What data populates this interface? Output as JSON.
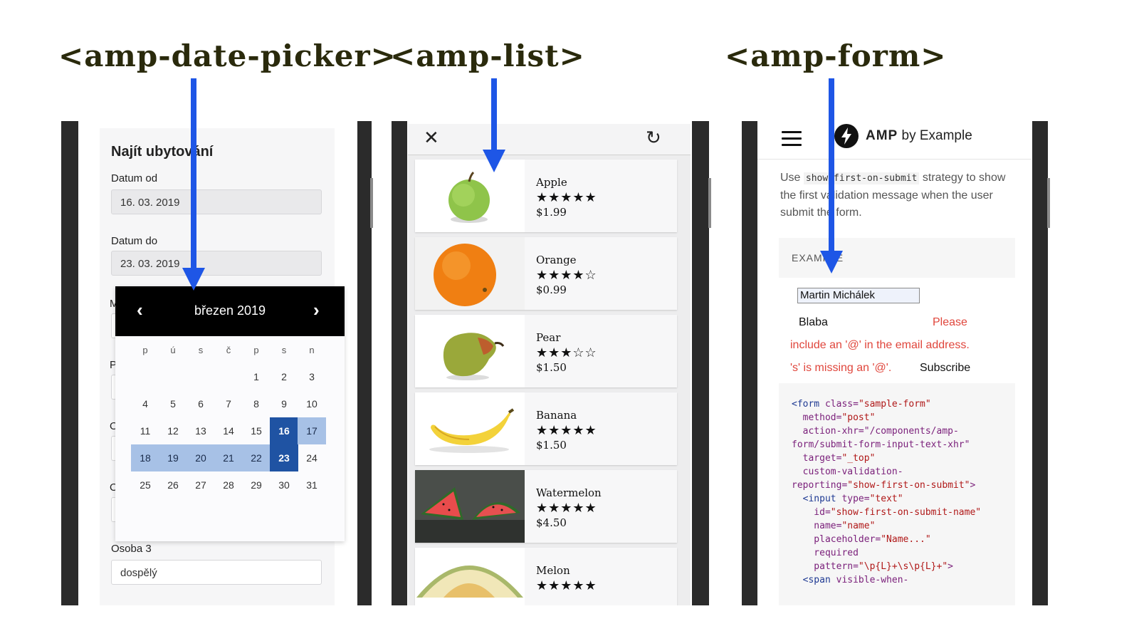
{
  "titles": {
    "date_picker": "<amp-date-picker>",
    "list": "<amp-list>",
    "form": "<amp-form>"
  },
  "date_picker": {
    "heading": "Najít ubytování",
    "from_label": "Datum od",
    "from_value": "16. 03. 2019",
    "to_label": "Datum do",
    "to_value": "23. 03. 2019",
    "stub_labels": [
      "M",
      "P",
      "O",
      "O"
    ],
    "person_label": "Osoba 3",
    "person_value": "dospělý",
    "calendar": {
      "month": "březen 2019",
      "prev_icon": "‹",
      "next_icon": "›",
      "weekdays": [
        "p",
        "ú",
        "s",
        "č",
        "p",
        "s",
        "n"
      ],
      "weeks": [
        [
          "",
          "",
          "",
          "",
          "1",
          "2",
          "3"
        ],
        [
          "4",
          "5",
          "6",
          "7",
          "8",
          "9",
          "10"
        ],
        [
          "11",
          "12",
          "13",
          "14",
          "15",
          "16",
          "17"
        ],
        [
          "18",
          "19",
          "20",
          "21",
          "22",
          "23",
          "24"
        ],
        [
          "25",
          "26",
          "27",
          "28",
          "29",
          "30",
          "31"
        ]
      ],
      "selected_start": "16",
      "selected_end": "23"
    }
  },
  "list": {
    "close_icon": "✕",
    "refresh_icon": "↻",
    "items": [
      {
        "name": "Apple",
        "stars": "★★★★★",
        "price": "$1.99",
        "image": "apple"
      },
      {
        "name": "Orange",
        "stars": "★★★★☆",
        "price": "$0.99",
        "image": "orange"
      },
      {
        "name": "Pear",
        "stars": "★★★☆☆",
        "price": "$1.50",
        "image": "pear"
      },
      {
        "name": "Banana",
        "stars": "★★★★★",
        "price": "$1.50",
        "image": "banana"
      },
      {
        "name": "Watermelon",
        "stars": "★★★★★",
        "price": "$4.50",
        "image": "watermelon"
      },
      {
        "name": "Melon",
        "stars": "★★★★★",
        "price": "",
        "image": "melon"
      }
    ]
  },
  "form": {
    "menu_icon": "hamburger-icon",
    "brand_bold": "AMP",
    "brand_rest": " by Example",
    "intro_before": "Use ",
    "intro_code": "show-first-on-submit",
    "intro_after": " strategy to show the first validation message when the user submit the form.",
    "example_label": "EXAMPLE",
    "name_value": "Martin Michálek",
    "email_value": "Blaba",
    "error_please": "Please",
    "error_line": "include an '@' in the email address.",
    "error_missing": "'s' is missing an '@'.",
    "subscribe_label": "Subscribe",
    "code_lines": [
      "<form class=\"sample-form\"",
      "  method=\"post\"",
      "  action-xhr=\"/components/amp-",
      "form/submit-form-input-text-xhr\"",
      "  target=\"_top\"",
      "  custom-validation-",
      "reporting=\"show-first-on-submit\">",
      "  <input type=\"text\"",
      "    id=\"show-first-on-submit-name\"",
      "    name=\"name\"",
      "    placeholder=\"Name...\"",
      "    required",
      "    pattern=\"\\p{L}+\\s\\p{L}+\">",
      "  <span visible-when-"
    ]
  },
  "colors": {
    "arrow": "#1e56e6",
    "calendar_selected": "#1f53a3",
    "calendar_range": "#a7c1e6",
    "error": "#e0463c",
    "title": "#2a2a0c"
  }
}
